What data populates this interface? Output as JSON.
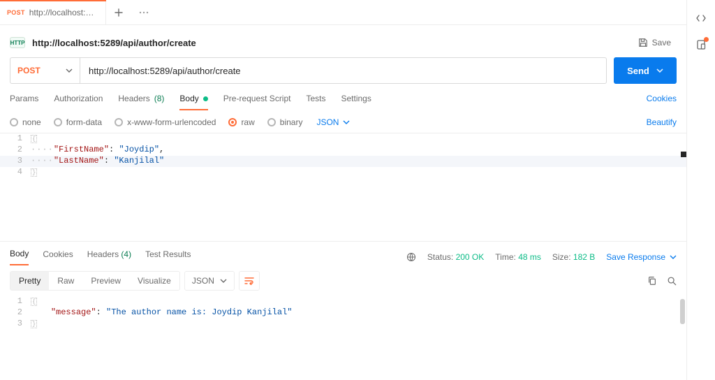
{
  "tabs": {
    "active": {
      "method": "POST",
      "title": "http://localhost:5289/ap"
    }
  },
  "request": {
    "badge": "HTTP",
    "title": "http://localhost:5289/api/author/create",
    "save_label": "Save",
    "method": "POST",
    "url": "http://localhost:5289/api/author/create",
    "send_label": "Send",
    "subtabs": {
      "params": "Params",
      "authorization": "Authorization",
      "headers": "Headers",
      "headers_count": "(8)",
      "body": "Body",
      "prerequest": "Pre-request Script",
      "tests": "Tests",
      "settings": "Settings",
      "cookies": "Cookies"
    },
    "bodytypes": {
      "none": "none",
      "formdata": "form-data",
      "xwww": "x-www-form-urlencoded",
      "raw": "raw",
      "binary": "binary",
      "json_dd": "JSON",
      "beautify": "Beautify"
    },
    "body_json": {
      "key1": "\"FirstName\"",
      "val1": "\"Joydip\"",
      "key2": "\"LastName\"",
      "val2": "\"Kanjilal\""
    }
  },
  "response": {
    "tabs": {
      "body": "Body",
      "cookies": "Cookies",
      "headers": "Headers",
      "headers_count": "(4)",
      "tests": "Test Results"
    },
    "meta": {
      "status_label": "Status:",
      "status_value": "200 OK",
      "time_label": "Time:",
      "time_value": "48 ms",
      "size_label": "Size:",
      "size_value": "182 B",
      "save": "Save Response"
    },
    "toolbar": {
      "pretty": "Pretty",
      "raw": "Raw",
      "preview": "Preview",
      "visualize": "Visualize",
      "json_dd": "JSON"
    },
    "body_json": {
      "key": "\"message\"",
      "val": "\"The author name is: Joydip Kanjilal\""
    }
  }
}
